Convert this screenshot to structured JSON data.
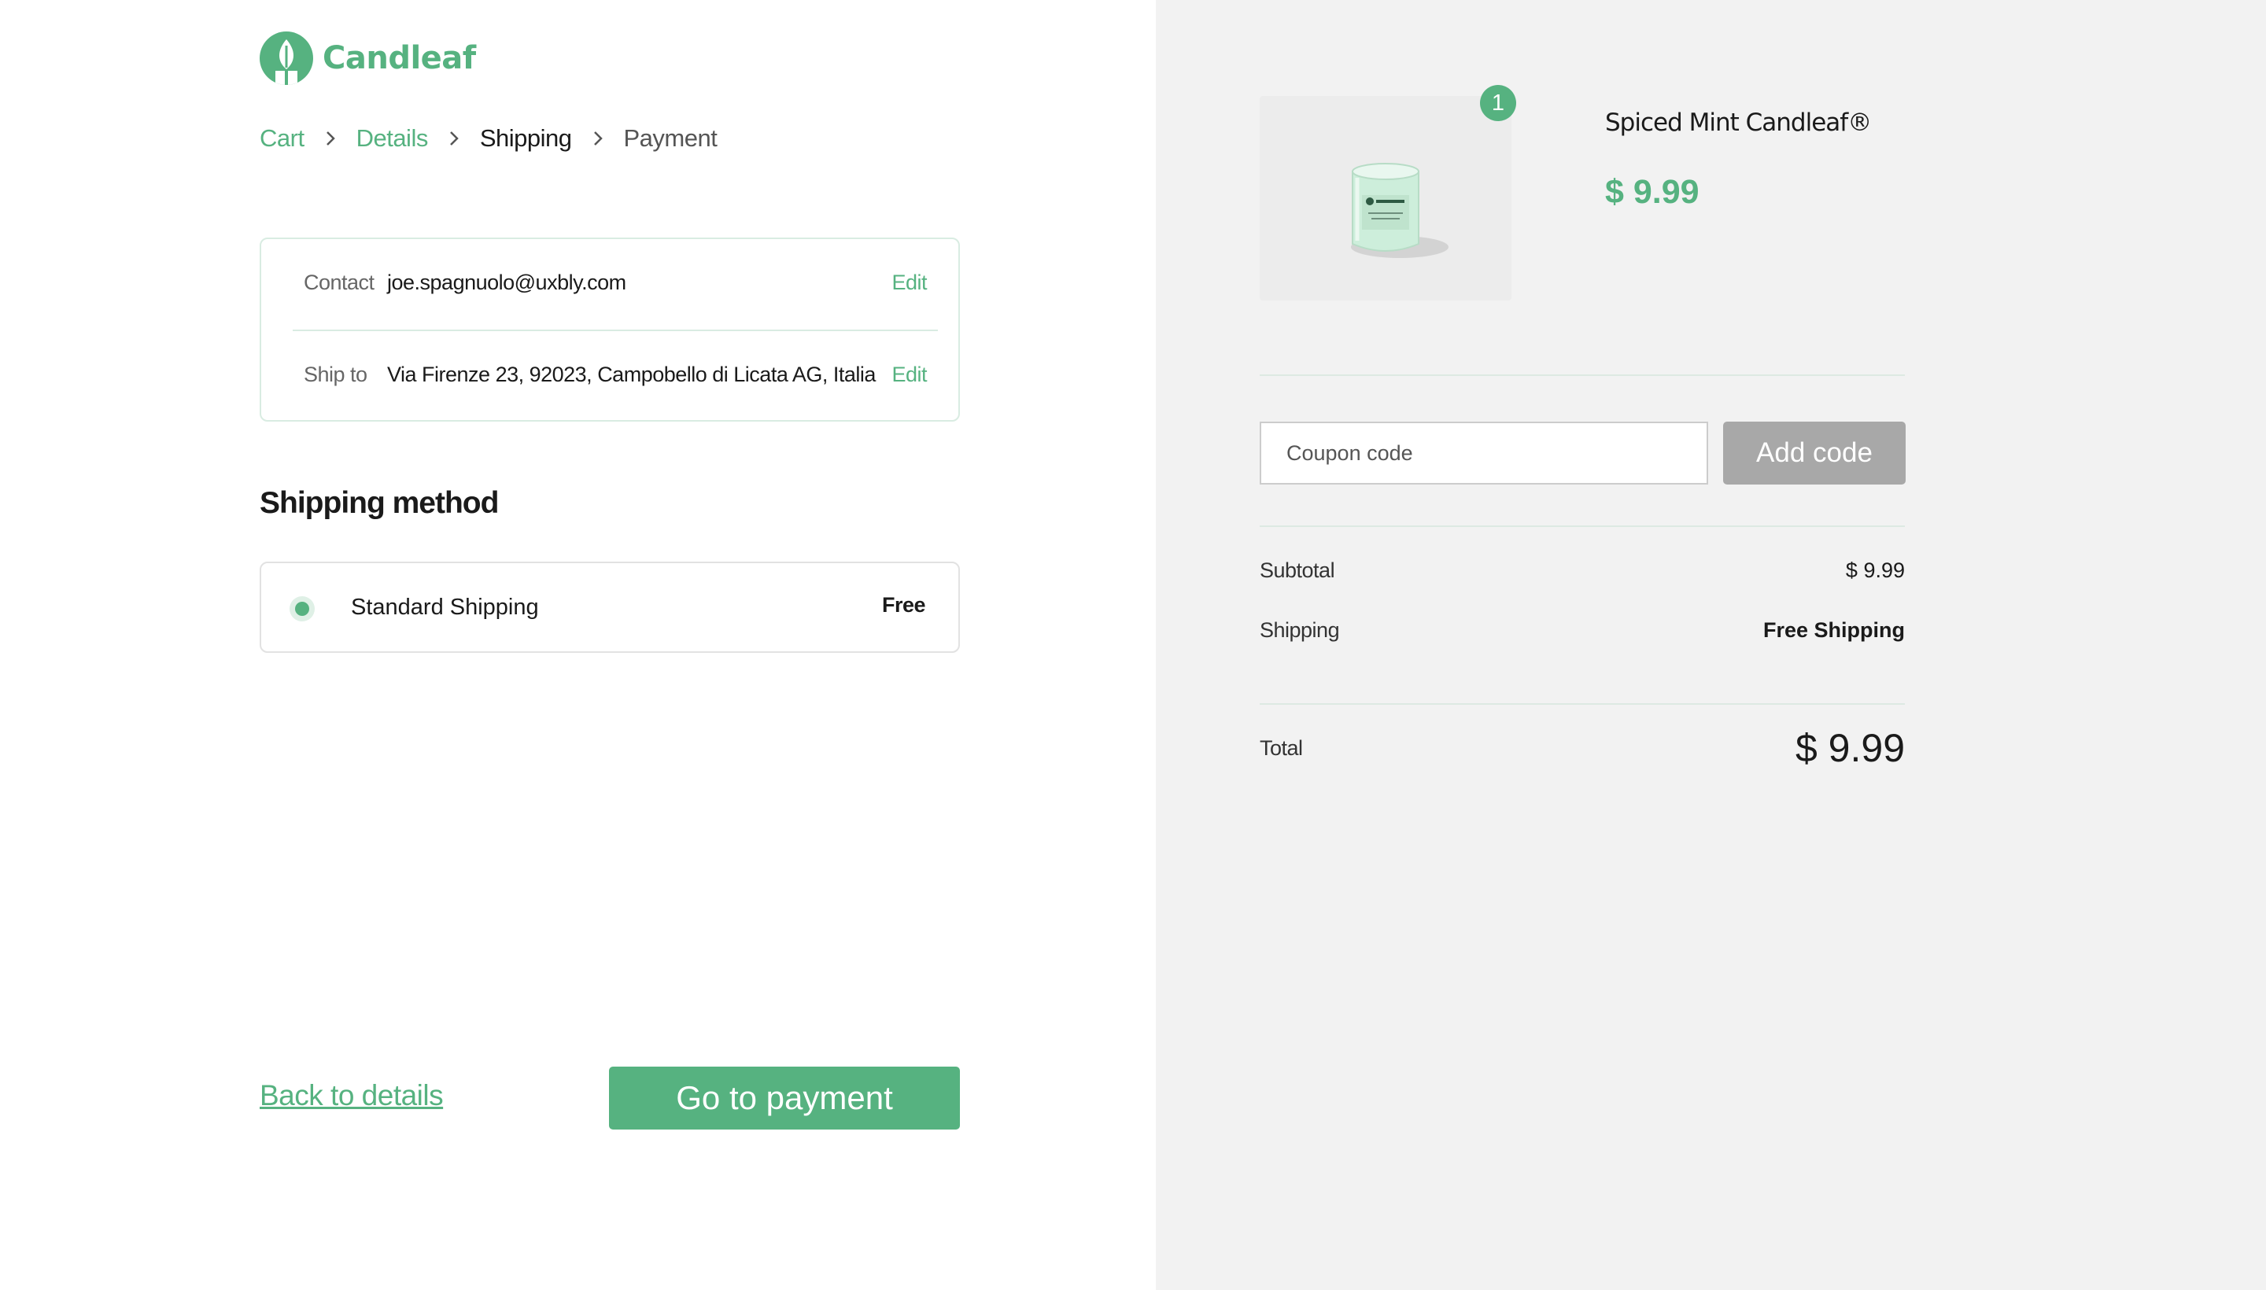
{
  "brand": {
    "name": "Candleaf",
    "color": "#56b280",
    "logo_icon": "leaf-candle-icon"
  },
  "breadcrumb": [
    {
      "label": "Cart",
      "state": "done"
    },
    {
      "label": "Details",
      "state": "done"
    },
    {
      "label": "Shipping",
      "state": "current"
    },
    {
      "label": "Payment",
      "state": "upcoming"
    }
  ],
  "info": {
    "contact": {
      "label": "Contact",
      "value": "joe.spagnuolo@uxbly.com",
      "edit": "Edit"
    },
    "ship_to": {
      "label": "Ship to",
      "value": "Via Firenze 23, 92023, Campobello di  Licata AG, Italia",
      "edit": "Edit"
    }
  },
  "shipping_method": {
    "title": "Shipping method",
    "option": {
      "name": "Standard Shipping",
      "price": "Free",
      "selected": true
    }
  },
  "actions": {
    "back_label": "Back to details",
    "primary_label": "Go to payment"
  },
  "cart": {
    "item": {
      "name": "Spiced Mint Candleaf®",
      "price": "$ 9.99",
      "quantity": "1",
      "image_icon": "candle-jar-image"
    },
    "coupon": {
      "placeholder": "Coupon code",
      "button": "Add code"
    },
    "summary": {
      "subtotal_label": "Subtotal",
      "subtotal_value": "$ 9.99",
      "shipping_label": "Shipping",
      "shipping_value": "Free Shipping",
      "total_label": "Total",
      "total_value": "$ 9.99"
    }
  }
}
